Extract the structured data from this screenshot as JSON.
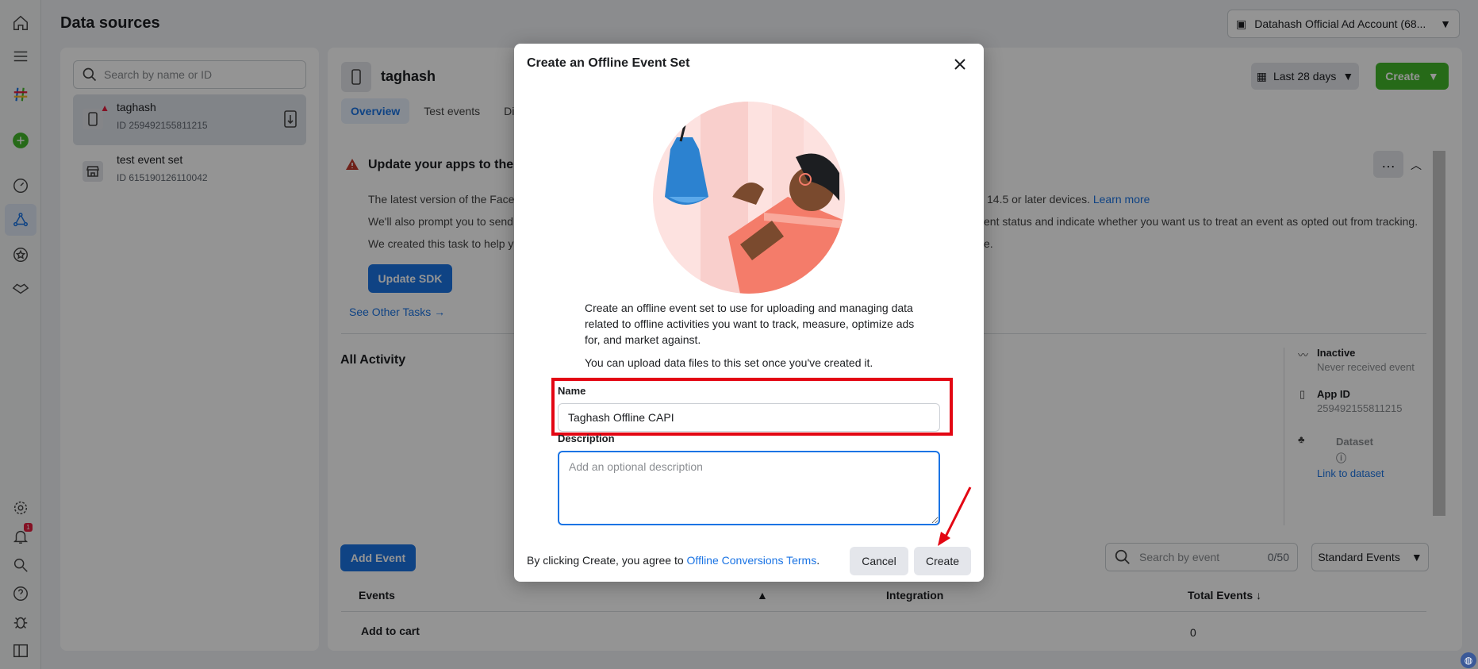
{
  "page_title": "Data sources",
  "account": {
    "label": "Datahash Official Ad Account (68..."
  },
  "search": {
    "placeholder": "Search by name or ID"
  },
  "sources": [
    {
      "name": "taghash",
      "id": "ID 259492155811215"
    },
    {
      "name": "test event set",
      "id": "ID 615190126110042"
    }
  ],
  "dataset": {
    "name": "taghash"
  },
  "tabs": [
    "Overview",
    "Test events",
    "Di"
  ],
  "date_range": "Last 28 days",
  "create_top": "Create",
  "alert": {
    "title": "Update your apps to the la",
    "line1": "The latest version of the Facel",
    "line1_end": "14.5 or later devices.",
    "learn_more": "Learn more",
    "line2": "We'll also prompt you to send",
    "line2_end": "ent status and indicate whether you want us to treat an event as opted out from tracking.",
    "line3": "We created this task to help yo",
    "line3_end": "e.",
    "update_sdk": "Update SDK",
    "see_other": "See Other Tasks →"
  },
  "all_activity": "All Activity",
  "side": {
    "status_title": "Inactive",
    "status_sub": "Never received event",
    "app_id_title": "App ID",
    "app_id": "259492155811215",
    "dataset_title": "Dataset",
    "dataset_link": "Link to dataset"
  },
  "add_event": "Add Event",
  "event_search": {
    "placeholder": "Search by event",
    "count": "0/50"
  },
  "standard_events": "Standard Events",
  "table": {
    "headers": [
      "Events",
      "Integration",
      "Total Events ↓"
    ],
    "rows": [
      {
        "event": "Add to cart",
        "total": "0"
      }
    ]
  },
  "notif_count": "1",
  "modal": {
    "title": "Create an Offline Event Set",
    "description": "Create an offline event set to use for uploading and managing data related to offline activities you want to track, measure, optimize ads for, and market against.",
    "description2": "You can upload data files to this set once you've created it.",
    "name_label": "Name",
    "name_value": "Taghash Offline CAPI",
    "desc_label": "Description",
    "desc_placeholder": "Add an optional description",
    "footer_text": "By clicking Create, you agree to",
    "footer_link": "Offline Conversions Terms",
    "cancel": "Cancel",
    "create": "Create"
  },
  "colors": {
    "accent": "#1b74e4",
    "green": "#42b72a",
    "highlight": "#e30613"
  }
}
